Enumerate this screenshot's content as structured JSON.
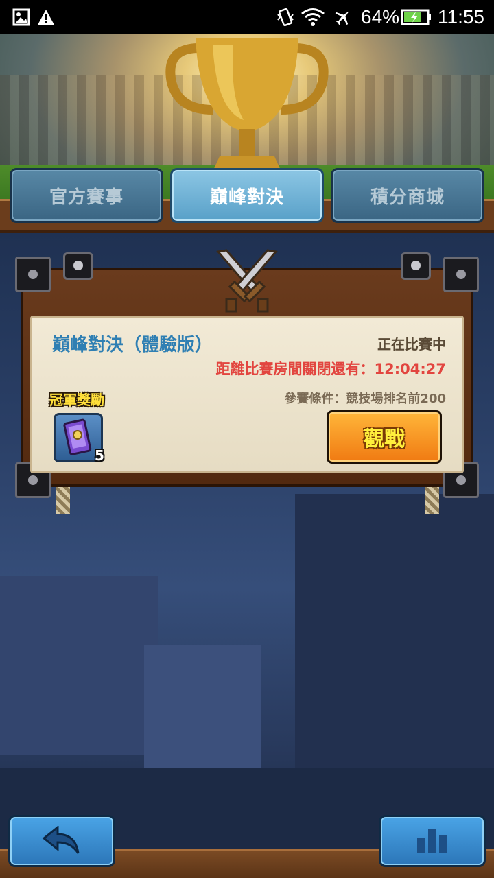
{
  "status_bar": {
    "battery_percent": "64%",
    "time": "11:55",
    "icons": [
      "image-icon",
      "warning-icon",
      "vibrate-icon",
      "wifi-icon",
      "airplane-icon",
      "battery-charging-icon"
    ]
  },
  "tabs": [
    {
      "label": "官方賽事",
      "active": false
    },
    {
      "label": "巔峰對決",
      "active": true
    },
    {
      "label": "積分商城",
      "active": false
    }
  ],
  "event": {
    "title": "巔峰對決（體驗版）",
    "status": "正在比賽中",
    "countdown_label": "距離比賽房間關閉還有：",
    "countdown_time": "12:04:27",
    "requirement": "參賽條件：競技場排名前200",
    "reward_label": "冠軍獎勵",
    "reward_item_icon": "scroll-icon",
    "reward_count": "5",
    "watch_button": "觀戰"
  },
  "bottom_bar": {
    "back_icon": "back-arrow-icon",
    "ranking_icon": "bar-chart-icon"
  },
  "colors": {
    "title_blue": "#2f7fb3",
    "countdown_red": "#e2453f",
    "watch_button_orange": "#f07a12",
    "tab_active": "#58a0c8",
    "tab_inactive": "#3a6583"
  }
}
